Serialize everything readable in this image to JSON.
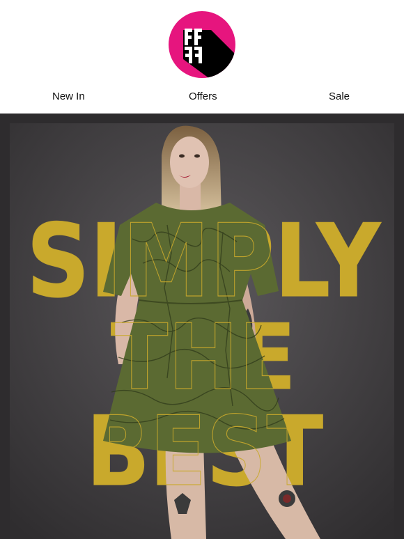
{
  "brand": {
    "logo_text": "FFFF",
    "logo_bg": "#e6157e",
    "logo_fg": "#000000"
  },
  "nav": {
    "items": [
      "New In",
      "Offers",
      "Sale"
    ]
  },
  "hero": {
    "headline_line1": "SIMPLY",
    "headline_line2": "THE",
    "headline_line3": "BEST",
    "headline_color": "#c9a92c",
    "background_color": "#4a474a",
    "dress_color": "#5b6a32"
  }
}
